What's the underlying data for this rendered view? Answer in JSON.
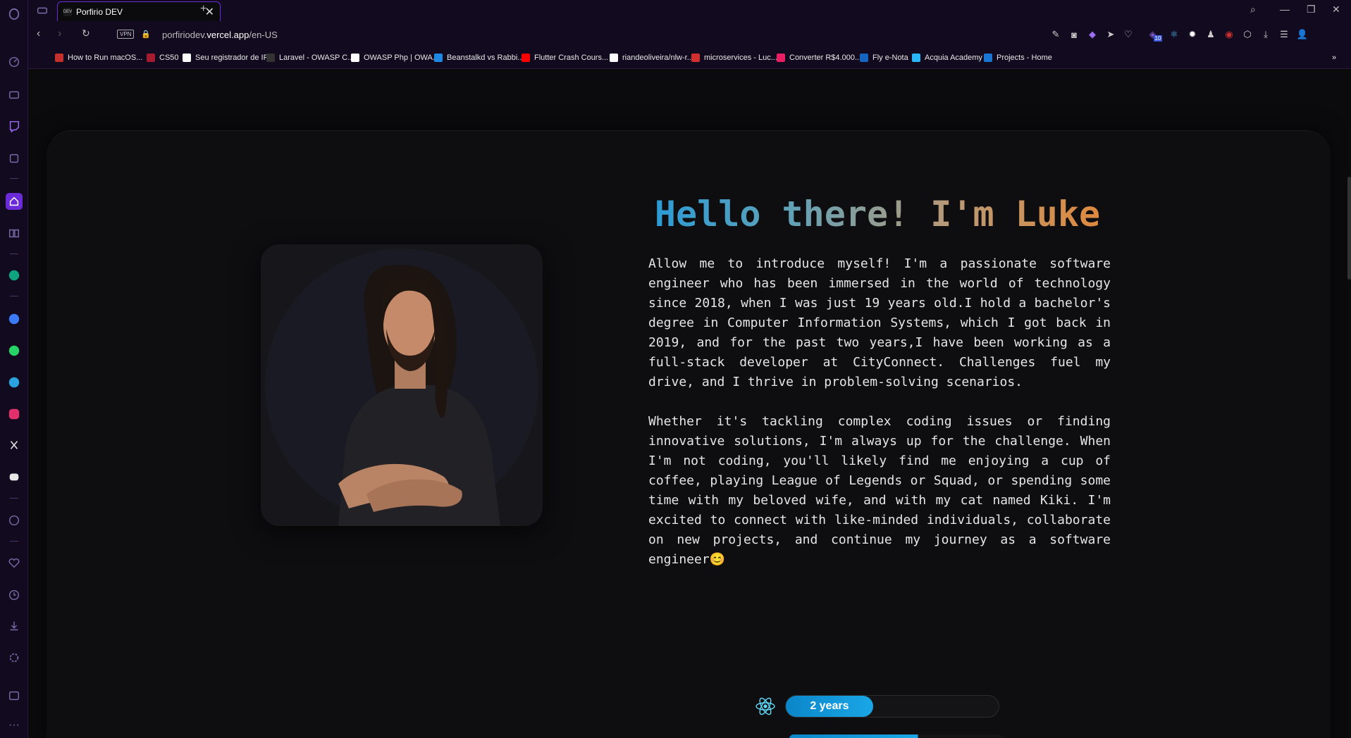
{
  "browser": {
    "tab_title": "Porfirio DEV",
    "favicon_text": "DEV",
    "url_prefix": "porfiriodev.",
    "url_domain": "vercel.app",
    "url_path": "/en-US",
    "vpn_label": "VPN",
    "new_tab": "+",
    "tab_close": "✕",
    "extension_badge": "10"
  },
  "bookmarks": [
    {
      "label": "How to Run macOS...",
      "color": "#c4302b"
    },
    {
      "label": "CS50",
      "color": "#a51c30"
    },
    {
      "label": "Seu registrador de IP",
      "color": "#ffffff"
    },
    {
      "label": "Laravel - OWASP C...",
      "color": "#333333"
    },
    {
      "label": "OWASP Php | OWA...",
      "color": "#ffffff"
    },
    {
      "label": "Beanstalkd vs Rabbi...",
      "color": "#1e88e5"
    },
    {
      "label": "Flutter Crash Cours...",
      "color": "#ff0000"
    },
    {
      "label": "riandeoliveira/nlw-r...",
      "color": "#ffffff"
    },
    {
      "label": "microservices - Luc...",
      "color": "#d32f2f"
    },
    {
      "label": "Converter R$4.000...",
      "color": "#e91e63"
    },
    {
      "label": "Fly e-Nota",
      "color": "#1565c0"
    },
    {
      "label": "Acquia Academy",
      "color": "#29b6f6"
    },
    {
      "label": "Projects - Home",
      "color": "#1976d2"
    }
  ],
  "hero": {
    "title": "Hello there! I'm Luke",
    "paragraph1": "Allow me to introduce myself! I'm a passionate software engineer who has been immersed in the world of technology since 2018, when I was just 19 years old.I hold a bachelor's degree in Computer Information Systems, which I got back in 2019, and for the past two years,I have been working as a full-stack developer at CityConnect. Challenges fuel my drive, and I thrive in problem-solving scenarios.",
    "paragraph2": "Whether it's tackling complex coding issues or finding innovative solutions, I'm always up for the challenge. When I'm not coding, you'll likely find me enjoying a cup of coffee, playing League of Legends or Squad, or spending some time with my beloved wife, and with my cat named Kiki. I'm excited to connect with like-minded individuals, collaborate on new projects, and continue my journey as a software engineer😊"
  },
  "skills": [
    {
      "icon": "react-icon",
      "label": "2 years",
      "fraction": 0.41
    }
  ],
  "colors": {
    "accent": "#6c2bd9",
    "title_gradient_start": "#2a9bd6",
    "title_gradient_end": "#e0893c",
    "skill_bar": "#0a86c9"
  }
}
